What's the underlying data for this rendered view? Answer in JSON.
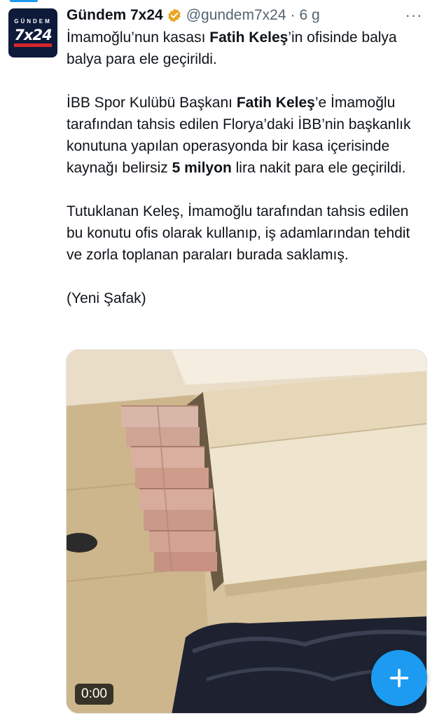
{
  "tweet": {
    "display_name": "Gündem 7x24",
    "handle": "@gundem7x24",
    "separator": "·",
    "time": "6 g",
    "more_label": "···",
    "avatar": {
      "small_word": "GÜNDEM",
      "big_word": "7x24"
    },
    "paragraph1": {
      "part1": "İmamoğlu’nun kasası ",
      "bold1": "Fatih Keleş",
      "part2": "’in ofisinde balya balya para ele geçirildi."
    },
    "paragraph2": {
      "part1": "İBB Spor Kulübü Başkanı ",
      "bold1": "Fatih Keleş",
      "part2": "’e İmamoğlu tarafından tahsis edilen Florya’daki İBB’nin başkanlık konutuna yapılan operasyonda bir kasa içerisinde kaynağı belirsiz ",
      "bold2": "5 milyon",
      "part3": " lira nakit para ele geçirildi."
    },
    "paragraph3": "Tutuklanan Keleş, İmamoğlu tarafından tahsis edilen bu konutu ofis olarak kullanıp, iş adamlarından tehdit ve zorla toplanan paraları burada saklamış.",
    "paragraph4": "(Yeni Şafak)",
    "video": {
      "timestamp": "0:00"
    }
  },
  "fab": {
    "icon": "plus-icon"
  },
  "colors": {
    "accent": "#1d9bf0",
    "verified_badge": "#e8a623",
    "text": "#0f1419",
    "secondary": "#536471"
  }
}
